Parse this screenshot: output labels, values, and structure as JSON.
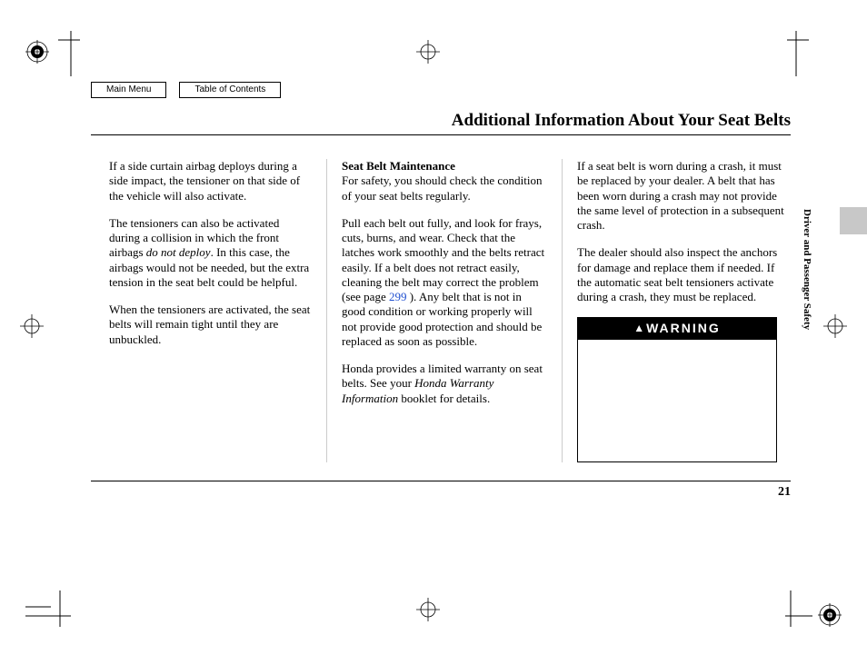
{
  "nav": {
    "main_menu": "Main Menu",
    "toc": "Table of Contents"
  },
  "title": "Additional Information About Your Seat Belts",
  "side_label": "Driver and Passenger Safety",
  "page_number": "21",
  "col1": {
    "p1": "If a side curtain airbag deploys during a side impact, the tensioner on that side of the vehicle will also activate.",
    "p2a": "The tensioners can also be activated during a collision in which the front airbags ",
    "p2b": "do not deploy",
    "p2c": ". In this case, the airbags would not be needed, but the extra tension in the seat belt could be helpful.",
    "p3": "When the tensioners are activated, the seat belts will remain tight until they are unbuckled."
  },
  "col2": {
    "h": "Seat Belt Maintenance",
    "p1": "For safety, you should check the condition of your seat belts regularly.",
    "p2a": "Pull each belt out fully, and look for frays, cuts, burns, and wear. Check that the latches work smoothly and the belts retract easily. If a belt does not retract easily, cleaning the belt may correct the problem (see page ",
    "p2b": "299",
    "p2c": " ). Any belt that is not in good condition or working properly will not provide good protection and should be replaced as soon as possible.",
    "p3a": "Honda provides a limited warranty on seat belts. See your ",
    "p3b": "Honda Warranty Information",
    "p3c": " booklet for details."
  },
  "col3": {
    "p1": "If a seat belt is worn during a crash, it must be replaced by your dealer. A belt that has been worn during a crash may not provide the same level of protection in a subsequent crash.",
    "p2": "The dealer should also inspect the anchors for damage and replace them if needed. If the automatic seat belt tensioners activate during a crash, they must be replaced.",
    "warning_label": "WARNING"
  }
}
